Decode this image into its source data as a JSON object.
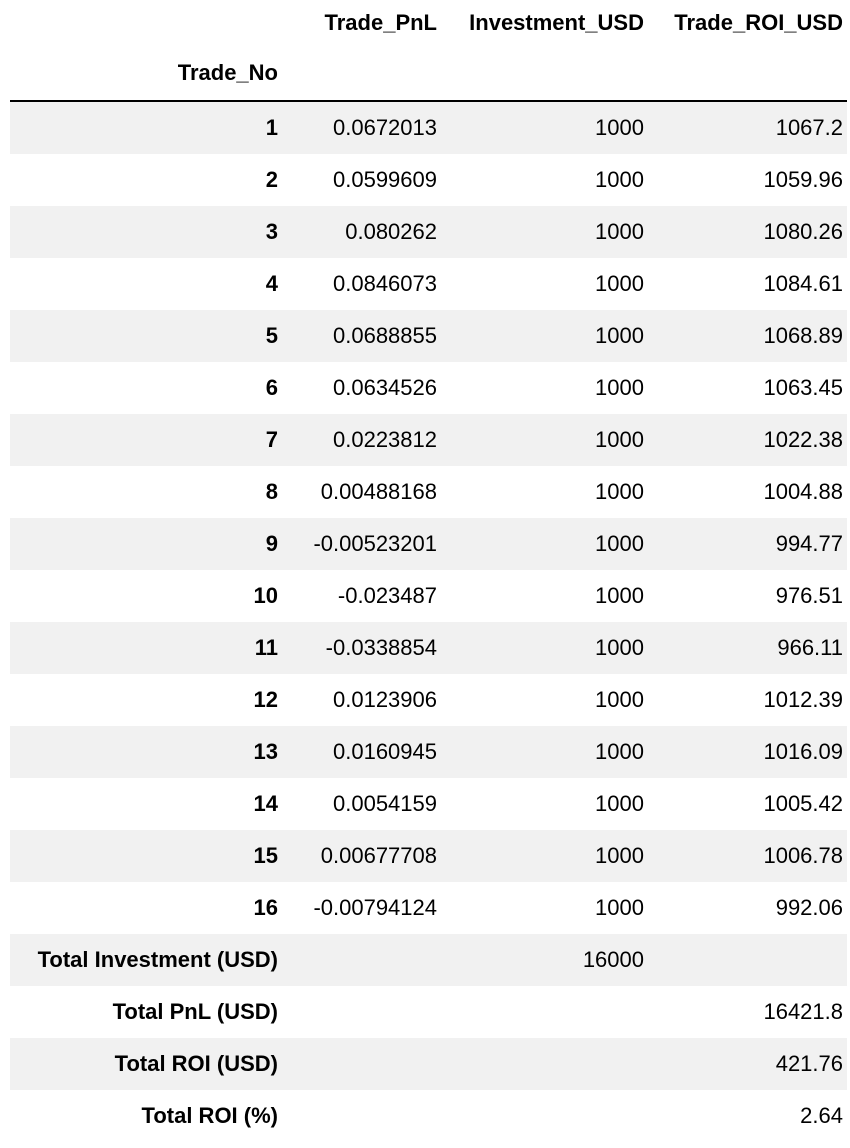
{
  "table": {
    "columns": [
      "Trade_PnL",
      "Investment_USD",
      "Trade_ROI_USD"
    ],
    "index_name": "Trade_No",
    "rows": [
      {
        "label": "1",
        "cells": [
          "0.0672013",
          "1000",
          "1067.2"
        ]
      },
      {
        "label": "2",
        "cells": [
          "0.0599609",
          "1000",
          "1059.96"
        ]
      },
      {
        "label": "3",
        "cells": [
          "0.080262",
          "1000",
          "1080.26"
        ]
      },
      {
        "label": "4",
        "cells": [
          "0.0846073",
          "1000",
          "1084.61"
        ]
      },
      {
        "label": "5",
        "cells": [
          "0.0688855",
          "1000",
          "1068.89"
        ]
      },
      {
        "label": "6",
        "cells": [
          "0.0634526",
          "1000",
          "1063.45"
        ]
      },
      {
        "label": "7",
        "cells": [
          "0.0223812",
          "1000",
          "1022.38"
        ]
      },
      {
        "label": "8",
        "cells": [
          "0.00488168",
          "1000",
          "1004.88"
        ]
      },
      {
        "label": "9",
        "cells": [
          "-0.00523201",
          "1000",
          "994.77"
        ]
      },
      {
        "label": "10",
        "cells": [
          "-0.023487",
          "1000",
          "976.51"
        ]
      },
      {
        "label": "11",
        "cells": [
          "-0.0338854",
          "1000",
          "966.11"
        ]
      },
      {
        "label": "12",
        "cells": [
          "0.0123906",
          "1000",
          "1012.39"
        ]
      },
      {
        "label": "13",
        "cells": [
          "0.0160945",
          "1000",
          "1016.09"
        ]
      },
      {
        "label": "14",
        "cells": [
          "0.0054159",
          "1000",
          "1005.42"
        ]
      },
      {
        "label": "15",
        "cells": [
          "0.00677708",
          "1000",
          "1006.78"
        ]
      },
      {
        "label": "16",
        "cells": [
          "-0.00794124",
          "1000",
          "992.06"
        ]
      },
      {
        "label": "Total Investment (USD)",
        "cells": [
          "",
          "16000",
          ""
        ]
      },
      {
        "label": "Total PnL (USD)",
        "cells": [
          "",
          "",
          "16421.8"
        ]
      },
      {
        "label": "Total ROI (USD)",
        "cells": [
          "",
          "",
          "421.76"
        ]
      },
      {
        "label": "Total ROI (%)",
        "cells": [
          "",
          "",
          "2.64"
        ]
      }
    ]
  }
}
